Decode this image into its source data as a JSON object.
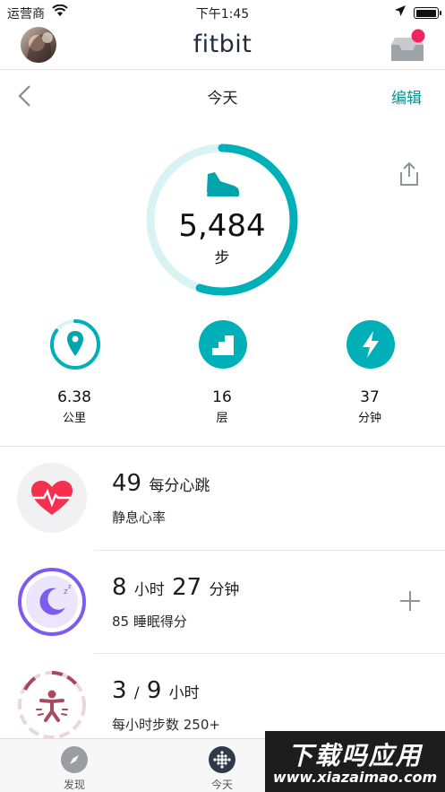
{
  "status_bar": {
    "carrier": "运营商",
    "time": "下午1:45",
    "battery_level": 1.0
  },
  "header": {
    "brand": "fitbit",
    "icons": {
      "avatar": "user-avatar",
      "inbox": "inbox-icon"
    },
    "notification_color": "#f0245e"
  },
  "date_bar": {
    "title": "今天",
    "edit_label": "编辑",
    "back_icon": "chevron-left-icon"
  },
  "steps": {
    "value": "5,484",
    "unit": "步",
    "progress": 0.55,
    "icon": "shoe-icon"
  },
  "share_icon": "share-icon",
  "stats": [
    {
      "value": "6.38",
      "unit": "公里",
      "icon": "location-pin-icon",
      "progress": 0.85
    },
    {
      "value": "16",
      "unit": "层",
      "icon": "stairs-icon",
      "progress": 1.0
    },
    {
      "value": "37",
      "unit": "分钟",
      "icon": "lightning-icon",
      "progress": 1.0
    }
  ],
  "cards": {
    "heart": {
      "value": "49",
      "value_unit": "每分心跳",
      "subtitle": "静息心率",
      "icon": "heart-rate-icon"
    },
    "sleep": {
      "hours": "8",
      "hours_unit": "小时",
      "minutes": "27",
      "minutes_unit": "分钟",
      "subtitle": "85 睡眠得分",
      "icon": "moon-icon"
    },
    "hourly": {
      "value": "3",
      "separator": "/",
      "goal": "9",
      "unit": "小时",
      "subtitle": "每小时步数 250+",
      "icon": "active-person-icon"
    }
  },
  "plus_icon": "plus-icon",
  "tab_bar": {
    "items": [
      {
        "label": "发现",
        "icon": "compass-icon"
      },
      {
        "label": "今天",
        "icon": "fitbit-dots-icon"
      }
    ]
  },
  "watermark": {
    "line1": "下载吗应用",
    "line2": "www.xiazaimao.com"
  },
  "colors": {
    "accent": "#00b0b9",
    "accent_light": "#d9f3f4",
    "heart": "#f4304f",
    "sleep": "#7b5cf0",
    "hourly": "#a54a5f",
    "edit": "#0e8f91"
  }
}
